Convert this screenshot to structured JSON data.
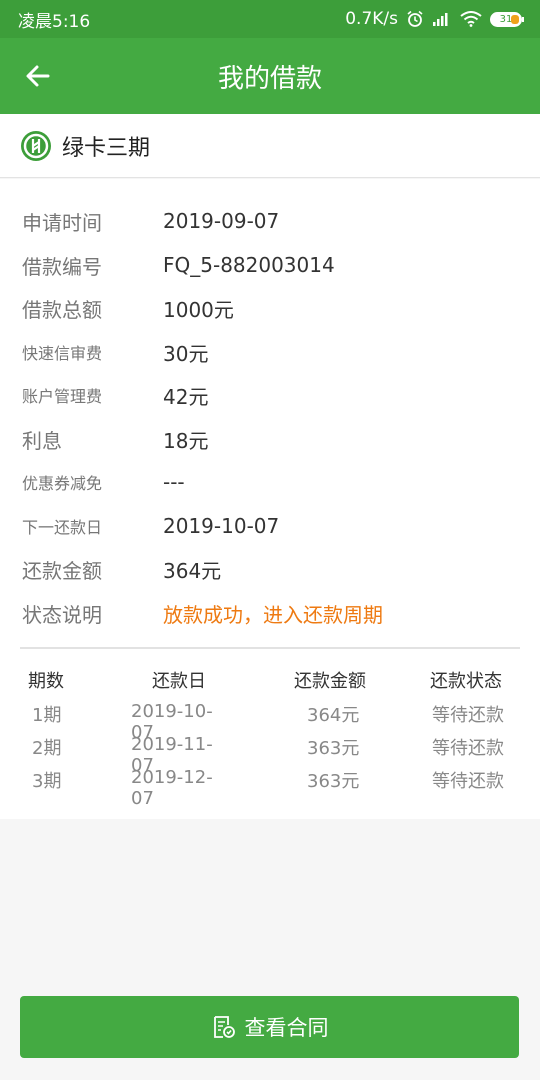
{
  "status_bar": {
    "time": "凌晨5:16",
    "speed": "0.7K/s",
    "battery": "31"
  },
  "app_bar": {
    "title": "我的借款",
    "back_icon": "arrow-left-icon"
  },
  "product": {
    "name": "绿卡三期",
    "logo_icon": "brand-logo-icon"
  },
  "details": [
    {
      "label": "申请时间",
      "value": "2019-09-07"
    },
    {
      "label": "借款编号",
      "value": "FQ_5-882003014"
    },
    {
      "label": "借款总额",
      "value": "1000元"
    },
    {
      "label": "快速信审费",
      "value": "30元"
    },
    {
      "label": "账户管理费",
      "value": "42元"
    },
    {
      "label": "利息",
      "value": "18元"
    },
    {
      "label": "优惠券减免",
      "value": "---"
    },
    {
      "label": "下一还款日",
      "value": "2019-10-07"
    },
    {
      "label": "还款金额",
      "value": "364元"
    },
    {
      "label": "状态说明",
      "value": "放款成功，进入还款周期"
    }
  ],
  "schedule": {
    "headers": [
      "期数",
      "还款日",
      "还款金额",
      "还款状态"
    ],
    "rows": [
      [
        "1期",
        "2019-10-07",
        "364元",
        "等待还款"
      ],
      [
        "2期",
        "2019-11-07",
        "363元",
        "等待还款"
      ],
      [
        "3期",
        "2019-12-07",
        "363元",
        "等待还款"
      ]
    ]
  },
  "footer": {
    "contract_button": "查看合同"
  },
  "colors": {
    "brand_green": "#44aa42",
    "status_orange": "#ee7a12"
  }
}
